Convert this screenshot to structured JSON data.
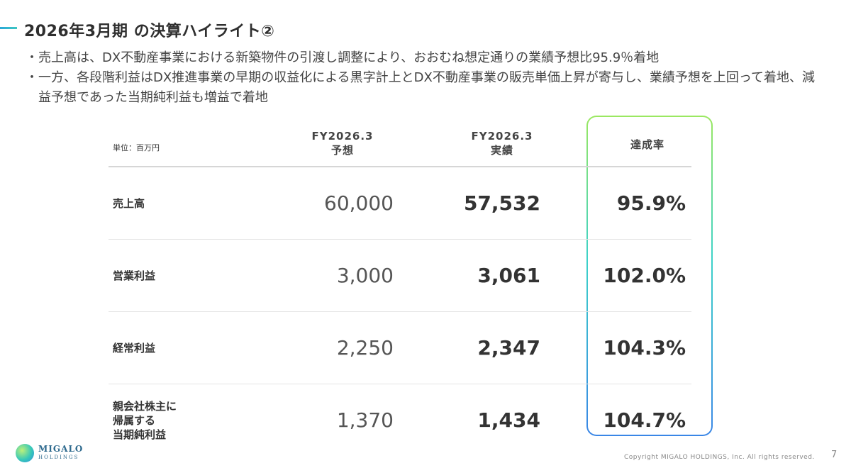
{
  "slide": {
    "title": "2026年3月期 の決算ハイライト②",
    "bullets": [
      "売上高は、DX不動産事業における新築物件の引渡し調整により、おおむね想定通りの業績予想比95.9％着地",
      "一方、各段階利益はDX推進事業の早期の収益化による黒字計上とDX不動産事業の販売単価上昇が寄与し、業績予想を上回って着地、減益予想であった当期純利益も増益で着地"
    ],
    "bullet_mark": "・"
  },
  "table": {
    "unit": "単位：百万円",
    "col_forecast": "FY2026.3\n予想",
    "col_forecast_l1": "FY2026.3",
    "col_forecast_l2": "予想",
    "col_actual_l1": "FY2026.3",
    "col_actual_l2": "実績",
    "col_rate": "達成率",
    "rows": [
      {
        "label": "売上高",
        "forecast": "60,000",
        "actual": "57,532",
        "rate": "95.9%"
      },
      {
        "label": "営業利益",
        "forecast": "3,000",
        "actual": "3,061",
        "rate": "102.0%"
      },
      {
        "label": "経常利益",
        "forecast": "2,250",
        "actual": "2,347",
        "rate": "104.3%"
      },
      {
        "label_l1": "親会社株主に",
        "label_l2": "帰属する",
        "label_l3": "当期純利益",
        "forecast": "1,370",
        "actual": "1,434",
        "rate": "104.7%"
      }
    ]
  },
  "footer": {
    "logo_l1": "MIGALO",
    "logo_l2": "HOLDINGS",
    "copyright": "Copyright MIGALO HOLDINGS, Inc. All rights reserved.",
    "page": "7"
  },
  "colors": {
    "highlight_top": "#9be860",
    "highlight_mid": "#3cd2c9",
    "highlight_bottom": "#3a86e6"
  }
}
